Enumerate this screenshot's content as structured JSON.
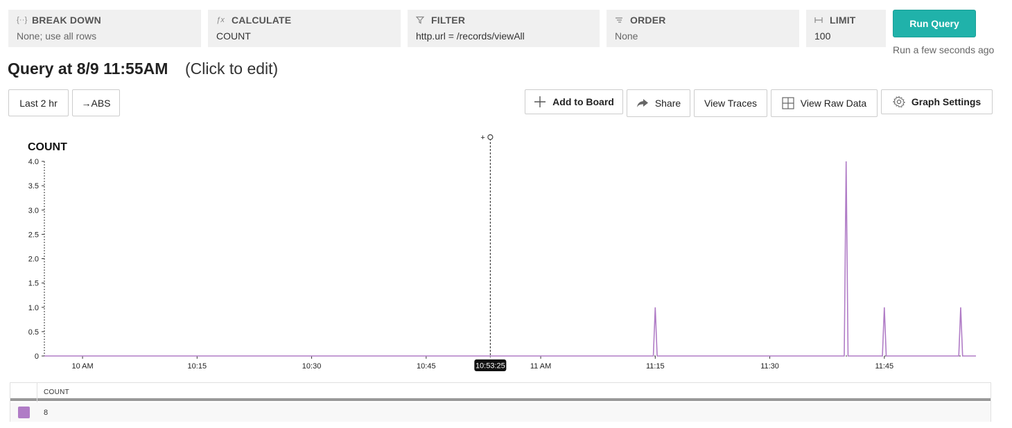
{
  "query_builder": {
    "breakdown": {
      "label": "BREAK DOWN",
      "value": "None; use all rows"
    },
    "calculate": {
      "label": "CALCULATE",
      "value": "COUNT"
    },
    "filter": {
      "label": "FILTER",
      "value": "http.url = /records/viewAll"
    },
    "order": {
      "label": "ORDER",
      "value": "None"
    },
    "limit": {
      "label": "LIMIT",
      "value": "100"
    },
    "run_label": "Run Query",
    "run_status": "Run a few seconds ago"
  },
  "query": {
    "title": "Query at 8/9 11:55AM",
    "edit_hint": "(Click to edit)"
  },
  "toolbar": {
    "time_range": "Last 2 hr",
    "abs": "→ABS",
    "add_to_board": "Add to Board",
    "share": "Share",
    "view_traces": "View Traces",
    "view_raw_data": "View Raw Data",
    "graph_settings": "Graph Settings"
  },
  "chart_data": {
    "type": "line",
    "title": "COUNT",
    "x_unit": "time (minutes after 09:55)",
    "x_range": [
      0,
      122
    ],
    "x_ticks": [
      {
        "value": 5,
        "label": "10 AM"
      },
      {
        "value": 20,
        "label": "10:15"
      },
      {
        "value": 35,
        "label": "10:30"
      },
      {
        "value": 50,
        "label": "10:45"
      },
      {
        "value": 65,
        "label": "11 AM"
      },
      {
        "value": 80,
        "label": "11:15"
      },
      {
        "value": 95,
        "label": "11:30"
      },
      {
        "value": 110,
        "label": "11:45"
      }
    ],
    "ylim": [
      0,
      4
    ],
    "y_ticks": [
      "0",
      "0.5",
      "1.0",
      "1.5",
      "2.0",
      "2.5",
      "3.0",
      "3.5",
      "4.0"
    ],
    "series": [
      {
        "name": "COUNT",
        "color": "#b07cc6",
        "points": [
          {
            "time": "11:15",
            "value": 1
          },
          {
            "time": "11:40",
            "value": 4
          },
          {
            "time": "11:45",
            "value": 1
          },
          {
            "time": "11:55",
            "value": 1
          }
        ]
      }
    ],
    "cursor": {
      "label": "10:53:25",
      "value_min": 58.4
    }
  },
  "legend_table": {
    "header": "COUNT",
    "rows": [
      {
        "color": "#b07cc6",
        "value": "8"
      }
    ]
  }
}
